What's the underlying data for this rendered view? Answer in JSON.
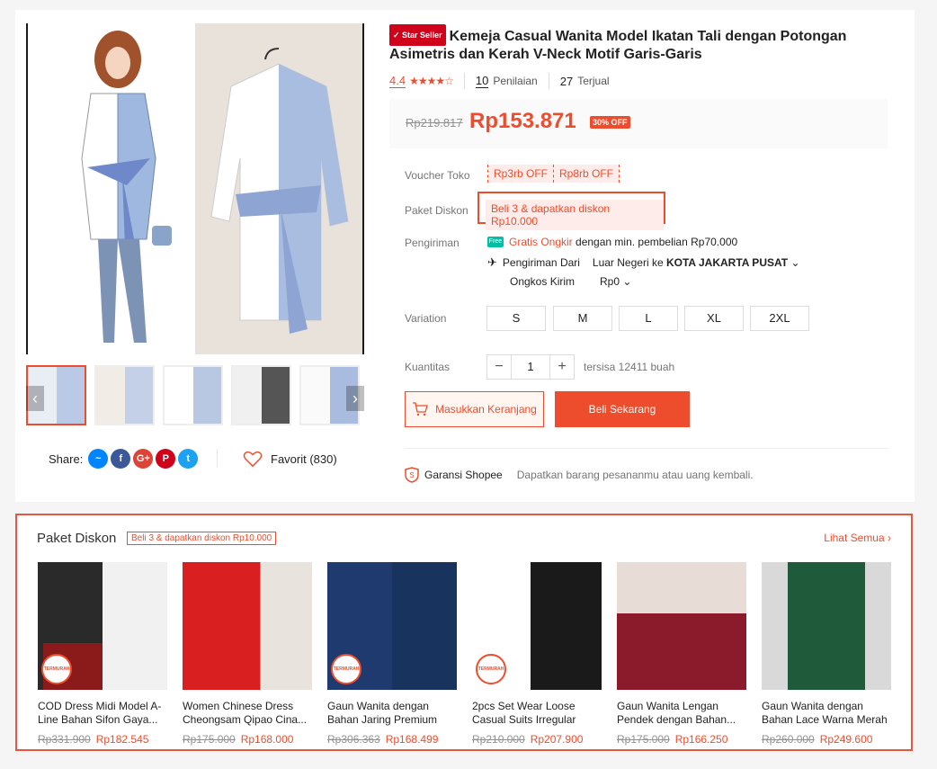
{
  "product": {
    "seller_badge": "Star Seller",
    "title": "Kemeja Casual Wanita Model Ikatan Tali dengan Potongan Asimetris dan Kerah V-Neck Motif Garis-Garis",
    "rating": "4.4",
    "stars": "★★★★☆",
    "reviews_count": "10",
    "reviews_label": "Penilaian",
    "sold_count": "27",
    "sold_label": "Terjual",
    "old_price": "Rp219.817",
    "price": "Rp153.871",
    "discount": "30% OFF"
  },
  "labels": {
    "voucher": "Voucher Toko",
    "paket": "Paket Diskon",
    "shipping": "Pengiriman",
    "variation": "Variation",
    "quantity": "Kuantitas"
  },
  "vouchers": [
    "Rp3rb OFF",
    "Rp8rb OFF"
  ],
  "paket_offer": "Beli 3 & dapatkan diskon Rp10.000",
  "shipping": {
    "free_badge": "Free",
    "free_text": "Gratis Ongkir",
    "free_cond": "dengan min. pembelian Rp70.000",
    "from_label": "Pengiriman Dari",
    "from_value": "Luar Negeri",
    "to_prefix": "ke",
    "to_value": "KOTA JAKARTA PUSAT",
    "cost_label": "Ongkos Kirim",
    "cost_value": "Rp0"
  },
  "variations": [
    "S",
    "M",
    "L",
    "XL",
    "2XL"
  ],
  "quantity": {
    "value": "1",
    "minus": "−",
    "plus": "+",
    "stock": "tersisa 12411 buah"
  },
  "buttons": {
    "cart": "Masukkan Keranjang",
    "buy": "Beli Sekarang"
  },
  "guarantee": {
    "title": "Garansi Shopee",
    "desc": "Dapatkan barang pesananmu atau uang kembali."
  },
  "share": {
    "label": "Share:",
    "favorite": "Favorit (830)"
  },
  "bundle": {
    "title": "Paket Diskon",
    "badge": "Beli 3 & dapatkan diskon Rp10.000",
    "see_all": "Lihat Semua",
    "termurah": "TERMURAH",
    "items": [
      {
        "name": "COD Dress Midi Model A-Line Bahan Sifon Gaya...",
        "old": "Rp331.900",
        "price": "Rp182.545"
      },
      {
        "name": "Women Chinese Dress Cheongsam Qipao Cina...",
        "old": "Rp175.000",
        "price": "Rp168.000"
      },
      {
        "name": "Gaun Wanita dengan Bahan Jaring Premium dan...",
        "old": "Rp306.363",
        "price": "Rp168.499"
      },
      {
        "name": "2pcs Set Wear Loose Casual Suits Irregular Top...",
        "old": "Rp210.000",
        "price": "Rp207.900"
      },
      {
        "name": "Gaun Wanita Lengan Pendek dengan Bahan...",
        "old": "Rp175.000",
        "price": "Rp166.250"
      },
      {
        "name": "Gaun Wanita dengan Bahan Lace Warna Merah dan...",
        "old": "Rp260.000",
        "price": "Rp249.600"
      }
    ]
  }
}
